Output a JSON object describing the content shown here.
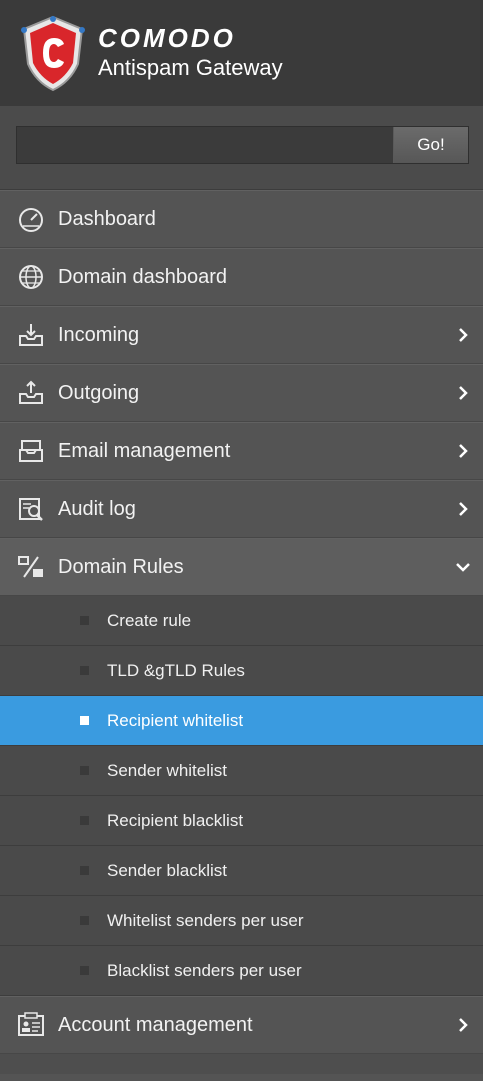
{
  "brand": {
    "name": "COMODO",
    "product": "Antispam Gateway"
  },
  "search": {
    "value": "",
    "placeholder": "",
    "go_label": "Go!"
  },
  "menu": {
    "dashboard": "Dashboard",
    "domain_dashboard": "Domain dashboard",
    "incoming": "Incoming",
    "outgoing": "Outgoing",
    "email_management": "Email management",
    "audit_log": "Audit log",
    "domain_rules": "Domain Rules",
    "account_management": "Account management"
  },
  "submenu": {
    "create_rule": "Create rule",
    "tld_rules": "TLD &gTLD Rules",
    "recipient_whitelist": "Recipient whitelist",
    "sender_whitelist": "Sender whitelist",
    "recipient_blacklist": "Recipient blacklist",
    "sender_blacklist": "Sender blacklist",
    "whitelist_per_user": "Whitelist senders per user",
    "blacklist_per_user": "Blacklist senders per user"
  },
  "active_item": "Recipient whitelist",
  "colors": {
    "active": "#3a9be0",
    "sidebar": "#545454",
    "header": "#3a3a3a",
    "logo_red": "#d9262b"
  },
  "icons": {
    "dashboard": "speedometer-icon",
    "domain_dashboard": "globe-icon",
    "incoming": "inbox-download-icon",
    "outgoing": "outbox-upload-icon",
    "email_management": "email-tray-icon",
    "audit_log": "audit-search-icon",
    "domain_rules": "percent-rules-icon",
    "account_management": "id-card-icon",
    "expand": "chevron-right-icon",
    "collapse": "chevron-down-icon"
  }
}
